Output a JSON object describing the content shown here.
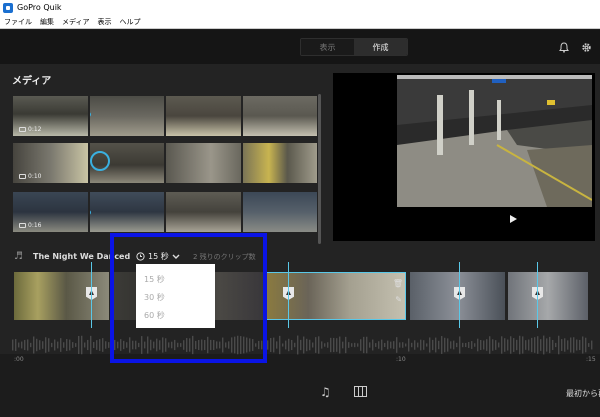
{
  "window": {
    "title": "GoPro Quik"
  },
  "menu": [
    "ファイル",
    "編集",
    "メディア",
    "表示",
    "ヘルプ"
  ],
  "topbar": {
    "tab_view": "表示",
    "tab_create": "作成",
    "icons": [
      "bell-icon",
      "gear-icon"
    ]
  },
  "media": {
    "title": "メディア",
    "durations": [
      "0:12",
      "0:10",
      "0:16"
    ]
  },
  "music": {
    "song": "The Night We Danced",
    "duration_selected": "15 秒",
    "clip_count": "2 残りのクリップ数",
    "options": [
      "15 秒",
      "30 秒",
      "60 秒"
    ]
  },
  "timeline": {
    "ticks": [
      ":00",
      ":10",
      ":15"
    ]
  },
  "footer": {
    "right_label": "最初から再"
  },
  "colors": {
    "accent": "#5ac8e8",
    "highlight": "#0a14e6"
  }
}
